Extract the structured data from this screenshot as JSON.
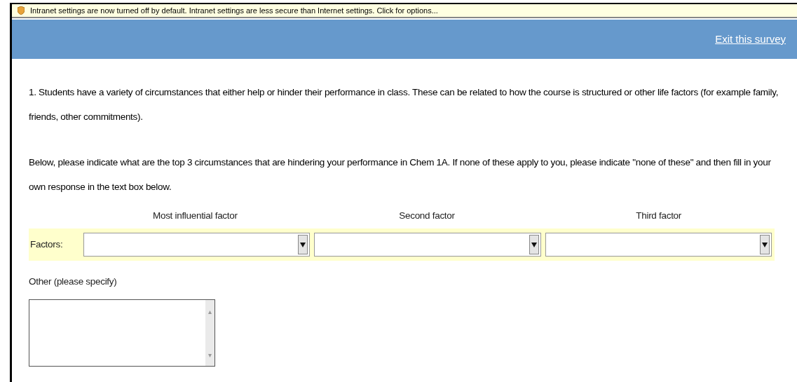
{
  "info_bar": {
    "text": "Intranet settings are now turned off by default. Intranet settings are less secure than Internet settings. Click for options..."
  },
  "header": {
    "exit_link": "Exit this survey"
  },
  "question": {
    "paragraphs": [
      "1. Students have a variety of circumstances that either help or hinder their performance in class. These can be related to how the course is structured or other life factors (for example family, friends, other commitments).",
      "Below, please indicate what are the top 3 circumstances that are hindering your performance in Chem 1A. If none of these apply to you, please indicate \"none of these\" and then fill in your own response in the text box below."
    ],
    "columns": [
      "Most influential factor",
      "Second factor",
      "Third factor"
    ],
    "row_label": "Factors:",
    "other_label": "Other (please specify)"
  }
}
